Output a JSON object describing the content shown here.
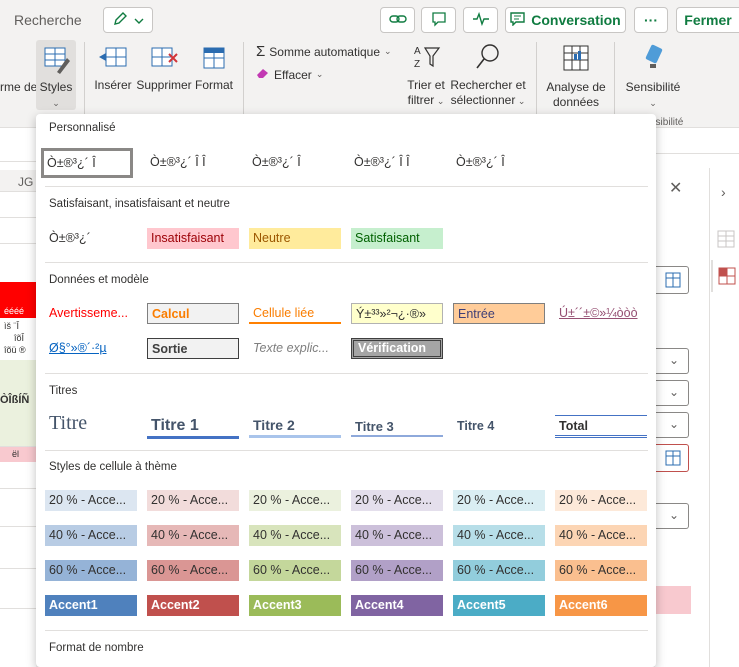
{
  "topbar": {
    "search_label": "Recherche",
    "conversation_label": "Conversation",
    "close_label": "Fermer",
    "more_label": "···"
  },
  "ribbon": {
    "mise_en_forme_label": "rme de",
    "styles_label": "Styles",
    "inserer_label": "Insérer",
    "supprimer_label": "Supprimer",
    "format_label": "Format",
    "somme_label": "Somme automatique",
    "effacer_label": "Effacer",
    "trier_label1": "Trier et",
    "trier_label2": "filtrer",
    "rechercher_label1": "Rechercher et",
    "rechercher_label2": "sélectionner",
    "analyse_label1": "Analyse de",
    "analyse_label2": "données",
    "sensibilite_label": "Sensibilité",
    "sensibilite_group": "nsibilité"
  },
  "sheet": {
    "col_label": "JG",
    "cell1": "éééé",
    "cell2": "ìš ¨Î",
    "cell3": "îõÎ",
    "cell4": "îõü ®",
    "cell5": "ÒÎßÍÑ",
    "cell6": "ël"
  },
  "dropdown": {
    "sections": {
      "custom": "Personnalisé",
      "good_bad": "Satisfaisant, insatisfaisant et neutre",
      "data_model": "Données et modèle",
      "titles": "Titres",
      "theme": "Styles de cellule à thème",
      "number": "Format de nombre"
    },
    "custom_styles": [
      "Ò±®³¿´ Î",
      "Ò±®³¿´ Î Î",
      "Ò±®³¿´ Î",
      "Ò±®³¿´ Î Î",
      "Ò±®³¿´ Î"
    ],
    "good_bad_styles": [
      "Ò±®³¿´",
      "Insatisfaisant",
      "Neutre",
      "Satisfaisant"
    ],
    "data_row1": [
      "Avertisseme...",
      "Calcul",
      "Cellule liée",
      "Ý±³³»²¬¿·®»",
      "Entrée",
      "Ú±´´±©»¼òòò"
    ],
    "data_row2": [
      "Ø§°»®´·²µ",
      "Sortie",
      "Texte explic...",
      "Vérification"
    ],
    "titles": [
      "Titre",
      "Titre 1",
      "Titre 2",
      "Titre 3",
      "Titre 4",
      "Total"
    ],
    "theme_20": [
      "20 % - Acce...",
      "20 % - Acce...",
      "20 % - Acce...",
      "20 % - Acce...",
      "20 % - Acce...",
      "20 % - Acce..."
    ],
    "theme_40": [
      "40 % - Acce...",
      "40 % - Acce...",
      "40 % - Acce...",
      "40 % - Acce...",
      "40 % - Acce...",
      "40 % - Acce..."
    ],
    "theme_60": [
      "60 % - Acce...",
      "60 % - Acce...",
      "60 % - Acce...",
      "60 % - Acce...",
      "60 % - Acce...",
      "60 % - Acce..."
    ],
    "accents": [
      "Accent1",
      "Accent2",
      "Accent3",
      "Accent4",
      "Accent5",
      "Accent6"
    ]
  },
  "colors": {
    "accent_green": "#107c41",
    "a20": [
      "#dce6f1",
      "#f2dcdb",
      "#ebf1de",
      "#e4dfec",
      "#daeef3",
      "#fde9d9"
    ],
    "a40": [
      "#b8cce4",
      "#e6b8b7",
      "#d8e4bc",
      "#ccc0da",
      "#b7dee8",
      "#fcd5b4"
    ],
    "a60": [
      "#95b3d7",
      "#da9694",
      "#c4d79b",
      "#b1a0c7",
      "#92cddc",
      "#fabf8f"
    ],
    "a100": [
      "#4f81bd",
      "#c0504d",
      "#9bbb59",
      "#8064a2",
      "#4bacc6",
      "#f79646"
    ]
  }
}
